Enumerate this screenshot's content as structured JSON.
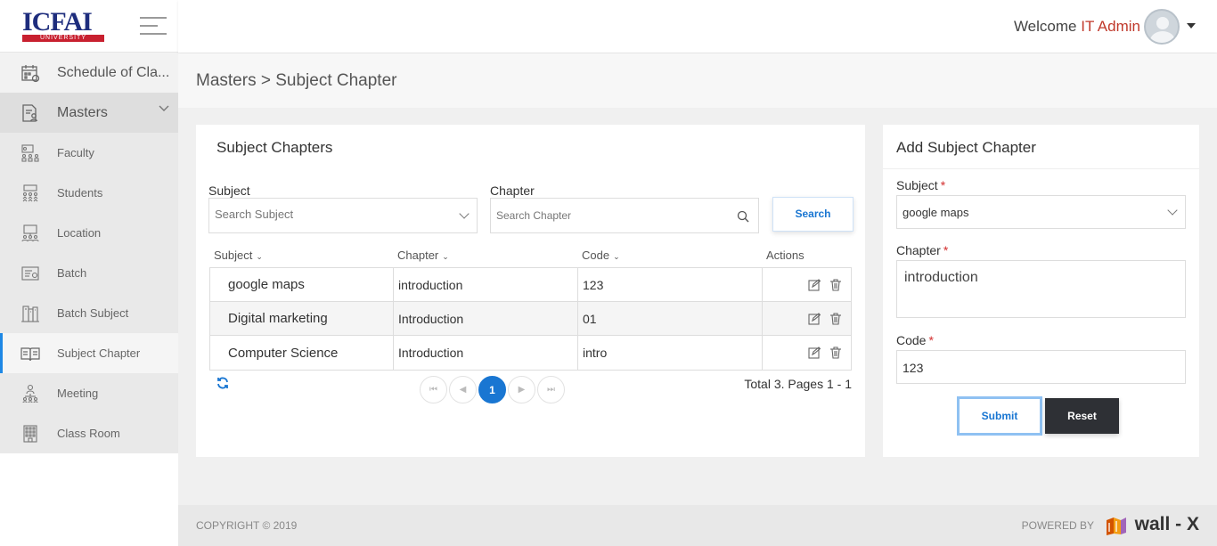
{
  "brand": {
    "logo_text": "ICFAI",
    "logo_sub": "UNIVERSITY"
  },
  "header": {
    "welcome": "Welcome",
    "user": "IT Admin"
  },
  "sidebar": {
    "items": [
      {
        "label": "Schedule of Cla...",
        "icon": "calendar-icon"
      },
      {
        "label": "Masters",
        "icon": "document-user-icon"
      },
      {
        "label": "Faculty",
        "icon": "faculty-icon"
      },
      {
        "label": "Students",
        "icon": "students-icon"
      },
      {
        "label": "Location",
        "icon": "location-icon"
      },
      {
        "label": "Batch",
        "icon": "batch-icon"
      },
      {
        "label": "Batch Subject",
        "icon": "batch-subject-icon"
      },
      {
        "label": "Subject Chapter",
        "icon": "book-icon"
      },
      {
        "label": "Meeting",
        "icon": "meeting-icon"
      },
      {
        "label": "Class Room",
        "icon": "building-icon"
      }
    ]
  },
  "breadcrumb": "Masters > Subject Chapter",
  "list": {
    "title": "Subject Chapters",
    "subject_label": "Subject",
    "subject_placeholder": "Search Subject",
    "chapter_label": "Chapter",
    "chapter_placeholder": "Search Chapter",
    "search_button": "Search",
    "columns": [
      "Subject",
      "Chapter",
      "Code",
      "Actions"
    ],
    "rows": [
      {
        "subject": "google maps",
        "chapter": "introduction",
        "code": "123"
      },
      {
        "subject": "Digital marketing",
        "chapter": "Introduction",
        "code": "01"
      },
      {
        "subject": "Computer Science",
        "chapter": "Introduction",
        "code": "intro"
      }
    ],
    "current_page": "1",
    "total_text": "Total 3. Pages 1 - 1"
  },
  "form": {
    "title": "Add Subject Chapter",
    "subject_label": "Subject",
    "subject_value": "google maps",
    "chapter_label": "Chapter",
    "chapter_value": "introduction",
    "code_label": "Code",
    "code_value": "123",
    "required_mark": "*",
    "submit": "Submit",
    "reset": "Reset"
  },
  "footer": {
    "copyright": "COPYRIGHT © 2019",
    "powered_by": "POWERED BY",
    "brand": "wall - X"
  },
  "colors": {
    "accent": "#1976d2",
    "active_bar": "#1e88e5",
    "user": "#c0392b",
    "required": "#d32f2f",
    "reset_bg": "#2e3035"
  }
}
